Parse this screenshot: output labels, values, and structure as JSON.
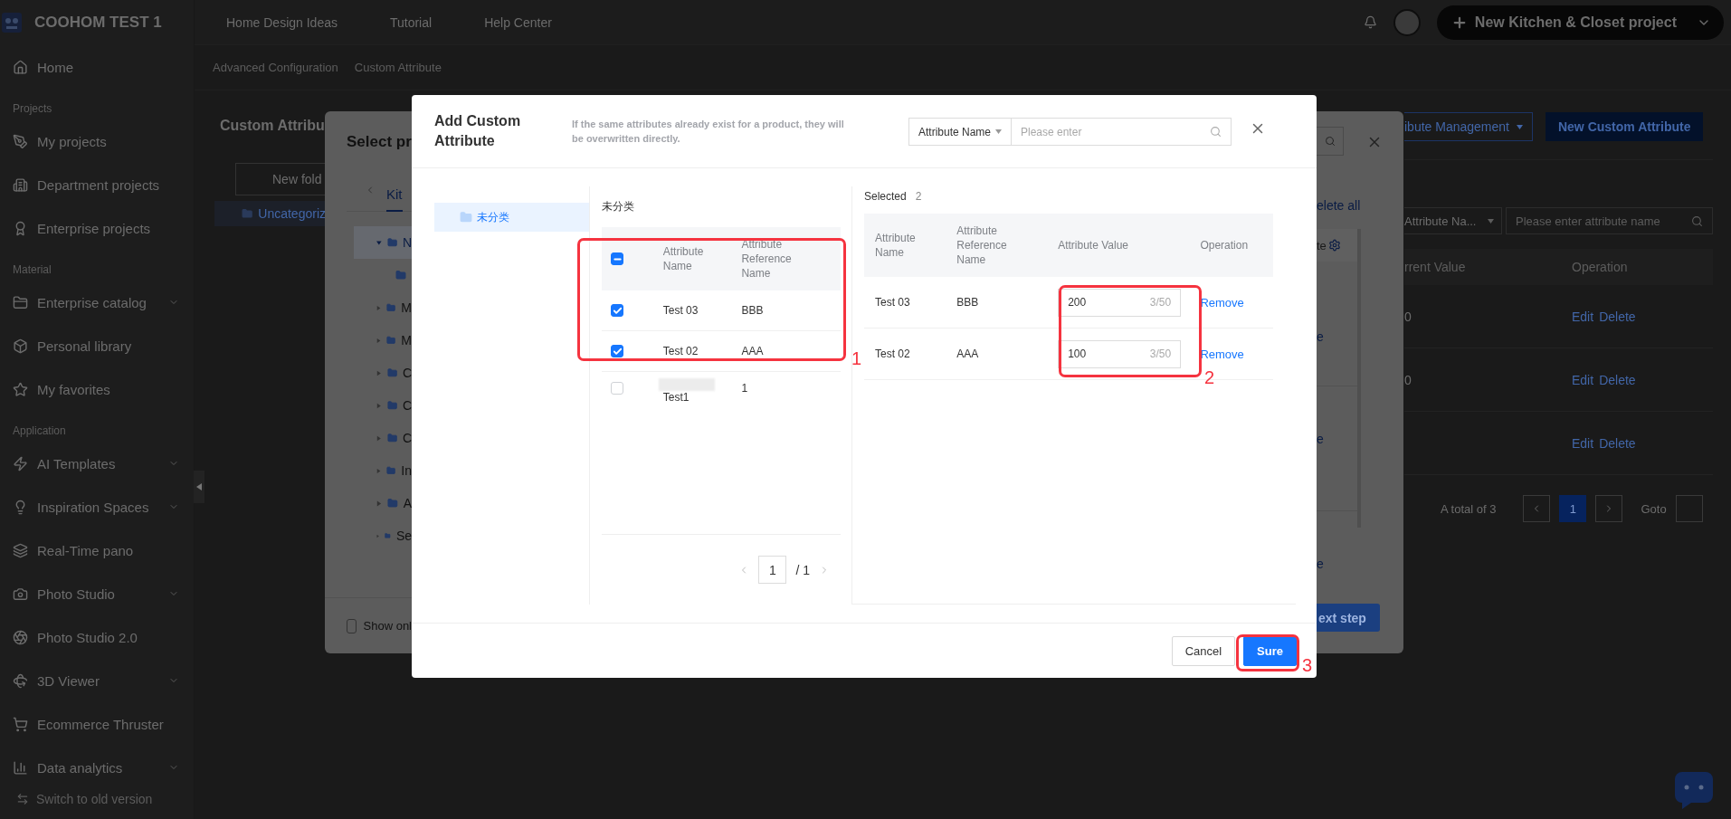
{
  "app": {
    "name": "COOHOM TEST 1"
  },
  "header": {
    "nav": [
      {
        "label": "Home Design Ideas"
      },
      {
        "label": "Tutorial"
      },
      {
        "label": "Help Center"
      }
    ],
    "primary_button": "New Kitchen & Closet project"
  },
  "sidebar": {
    "sections": [
      {
        "items": [
          {
            "label": "Home",
            "has_submenu": false
          }
        ]
      },
      {
        "title": "Projects",
        "items": [
          {
            "label": "My projects",
            "has_submenu": false
          },
          {
            "label": "Department projects",
            "has_submenu": false
          },
          {
            "label": "Enterprise projects",
            "has_submenu": false
          }
        ]
      },
      {
        "title": "Material",
        "items": [
          {
            "label": "Enterprise catalog",
            "has_submenu": true
          },
          {
            "label": "Personal library",
            "has_submenu": false
          },
          {
            "label": "My favorites",
            "has_submenu": false
          }
        ]
      },
      {
        "title": "Application",
        "items": [
          {
            "label": "AI Templates",
            "has_submenu": true
          },
          {
            "label": "Inspiration Spaces",
            "has_submenu": true
          },
          {
            "label": "Real-Time pano",
            "has_submenu": false
          },
          {
            "label": "Photo Studio",
            "has_submenu": true
          },
          {
            "label": "Photo Studio 2.0",
            "has_submenu": false
          },
          {
            "label": "3D Viewer",
            "has_submenu": true
          },
          {
            "label": "Ecommerce Thruster",
            "has_submenu": false
          },
          {
            "label": "Data analytics",
            "has_submenu": true
          }
        ]
      }
    ],
    "footer": "Switch to old version"
  },
  "breadcrumb": [
    "Advanced Configuration",
    "Custom Attribute"
  ],
  "page": {
    "title": "Custom Attribu",
    "new_folder": "New fold",
    "folder": "Uncategoriz",
    "management_button": "ibute Management",
    "new_button": "New Custom Attribute",
    "filter_select": "Attribute Na...",
    "search_placeholder": "Please enter attribute name",
    "columns": [
      "rrent Value",
      "Operation"
    ],
    "rows": [
      {
        "value": "0",
        "actions": [
          "Edit",
          "Delete"
        ]
      },
      {
        "value": "0",
        "actions": [
          "Edit",
          "Delete"
        ]
      },
      {
        "actions": [
          "Edit",
          "Delete"
        ]
      }
    ],
    "pagination": {
      "total": "A total of 3",
      "pages": [
        {
          "label": "1",
          "selected": true
        }
      ],
      "goto": "Goto"
    }
  },
  "product_dialog": {
    "title": "Select pr",
    "tab": "Kit",
    "tree": [
      {
        "label": "N",
        "expanded": true,
        "selected": true,
        "children": [
          {
            "kind": "folder"
          }
        ]
      },
      {
        "label": "M",
        "expanded": false,
        "selected": false
      },
      {
        "label": "M",
        "expanded": false,
        "selected": false
      },
      {
        "label": "C",
        "expanded": false,
        "selected": false
      },
      {
        "label": "C",
        "expanded": false,
        "selected": false
      },
      {
        "label": "C",
        "expanded": false,
        "selected": false
      },
      {
        "label": "In",
        "expanded": false,
        "selected": false
      },
      {
        "label": "A",
        "expanded": false,
        "selected": false
      },
      {
        "label": "Se",
        "expanded": false,
        "selected": false
      }
    ],
    "show_only": {
      "label": "Show onl",
      "checked": false
    },
    "delete_all": "elete all",
    "header_fragment": "te",
    "row_fragments": [
      "e",
      "e",
      "e"
    ],
    "next_button": "ext step"
  },
  "attribute_dialog": {
    "title": "Add Custom Attribute",
    "notice": "If the same attributes already exist for a product, they will be overwritten directly.",
    "search": {
      "field": "Attribute Name",
      "placeholder": "Please enter"
    },
    "categories": [
      {
        "label": "未分类",
        "selected": true
      }
    ],
    "list": {
      "title": "未分类",
      "select_all": {
        "checked": true,
        "indeterminate": true
      },
      "columns": [
        "Attribute Name",
        "Attribute Reference Name"
      ],
      "rows": [
        {
          "name": "Test 03",
          "reference": "BBB",
          "checked": true
        },
        {
          "name": "Test 02",
          "reference": "AAA",
          "checked": true
        },
        {
          "name": "Test1",
          "reference": "1",
          "checked": false
        }
      ],
      "pagination": {
        "page": "1",
        "total": "/ 1"
      }
    },
    "selected": {
      "label": "Selected",
      "count": "2",
      "columns": [
        "Attribute Name",
        "Attribute Reference Name",
        "Attribute Value",
        "Operation"
      ],
      "rows": [
        {
          "name": "Test 03",
          "reference": "BBB",
          "value": "200",
          "counter": "3/50",
          "action": "Remove"
        },
        {
          "name": "Test 02",
          "reference": "AAA",
          "value": "100",
          "counter": "3/50",
          "action": "Remove"
        }
      ]
    },
    "buttons": [
      {
        "label": "Cancel",
        "kind": "secondary"
      },
      {
        "label": "Sure",
        "kind": "primary"
      }
    ]
  },
  "annotations": [
    {
      "label": "1"
    },
    {
      "label": "2"
    },
    {
      "label": "3"
    }
  ]
}
